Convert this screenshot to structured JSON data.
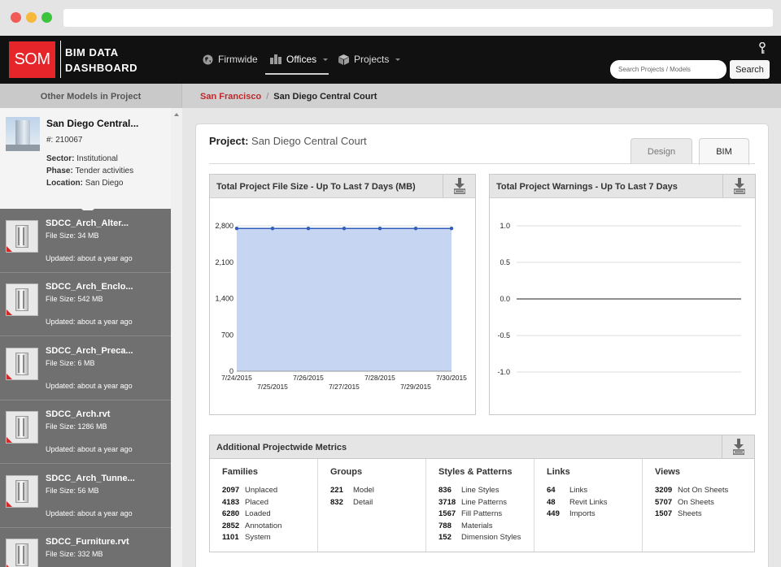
{
  "header": {
    "logo": "SOM",
    "brand_line1": "BIM DATA",
    "brand_line2": "DASHBOARD",
    "nav": [
      {
        "label": "Firmwide",
        "icon": "globe-icon"
      },
      {
        "label": "Offices",
        "icon": "city-icon"
      },
      {
        "label": "Projects",
        "icon": "cube-icon"
      }
    ],
    "search_placeholder": "Search Projects / Models",
    "search_button": "Search"
  },
  "subheader": {
    "sidebar_title": "Other Models in Project",
    "breadcrumb_link": "San Francisco",
    "breadcrumb_sep": "/",
    "breadcrumb_current": "San Diego Central Court"
  },
  "current_model": {
    "title": "San Diego Central...",
    "number": "#: 210067",
    "sector_label": "Sector:",
    "sector": "Institutional",
    "phase_label": "Phase:",
    "phase": "Tender activities",
    "location_label": "Location:",
    "location": "San Diego"
  },
  "models": [
    {
      "name": "SDCC_Arch_Alter...",
      "size": "File Size: 34 MB",
      "updated": "Updated: about a year ago"
    },
    {
      "name": "SDCC_Arch_Enclo...",
      "size": "File Size: 542 MB",
      "updated": "Updated: about a year ago"
    },
    {
      "name": "SDCC_Arch_Preca...",
      "size": "File Size: 6 MB",
      "updated": "Updated: about a year ago"
    },
    {
      "name": "SDCC_Arch.rvt",
      "size": "File Size: 1286 MB",
      "updated": "Updated: about a year ago"
    },
    {
      "name": "SDCC_Arch_Tunne...",
      "size": "File Size: 56 MB",
      "updated": "Updated: about a year ago"
    },
    {
      "name": "SDCC_Furniture.rvt",
      "size": "File Size: 332 MB",
      "updated": ""
    }
  ],
  "project": {
    "label": "Project:",
    "name": "San Diego Central Court",
    "tabs": [
      "Design",
      "BIM"
    ]
  },
  "chart_data": [
    {
      "type": "area",
      "title": "Total Project File Size - Up To Last 7 Days (MB)",
      "x": [
        "7/24/2015",
        "7/25/2015",
        "7/26/2015",
        "7/27/2015",
        "7/28/2015",
        "7/29/2015",
        "7/30/2015"
      ],
      "values": [
        2750,
        2750,
        2750,
        2750,
        2750,
        2750,
        2750
      ],
      "yticks": [
        0,
        700,
        1400,
        2100,
        2800
      ],
      "ylim": [
        0,
        2800
      ],
      "color": "#c5d5f2",
      "line_color": "#2f5db8"
    },
    {
      "type": "line",
      "title": "Total Project Warnings - Up To Last 7 Days",
      "x": [],
      "values": [
        0
      ],
      "yticks": [
        1.0,
        0.5,
        0.0,
        -0.5,
        -1.0
      ],
      "ytick_labels": [
        "1.0",
        "0.5",
        "0.0",
        "-0.5",
        "-1.0"
      ],
      "ylim": [
        -1.0,
        1.0
      ]
    }
  ],
  "metrics": {
    "title": "Additional Projectwide Metrics",
    "columns": [
      {
        "title": "Families",
        "rows": [
          {
            "n": "2097",
            "label": "Unplaced"
          },
          {
            "n": "4183",
            "label": "Placed"
          },
          {
            "n": "6280",
            "label": "Loaded"
          },
          {
            "n": "2852",
            "label": "Annotation"
          },
          {
            "n": "1101",
            "label": "System"
          }
        ]
      },
      {
        "title": "Groups",
        "rows": [
          {
            "n": "221",
            "label": "Model"
          },
          {
            "n": "832",
            "label": "Detail"
          }
        ]
      },
      {
        "title": "Styles & Patterns",
        "rows": [
          {
            "n": "836",
            "label": "Line Styles"
          },
          {
            "n": "3718",
            "label": "Line Patterns"
          },
          {
            "n": "1567",
            "label": "Fill Patterns"
          },
          {
            "n": "788",
            "label": "Materials"
          },
          {
            "n": "152",
            "label": "Dimension Styles"
          }
        ]
      },
      {
        "title": "Links",
        "rows": [
          {
            "n": "64",
            "label": "Links"
          },
          {
            "n": "48",
            "label": "Revit Links"
          },
          {
            "n": "449",
            "label": "Imports"
          }
        ]
      },
      {
        "title": "Views",
        "rows": [
          {
            "n": "3209",
            "label": "Not On Sheets"
          },
          {
            "n": "5707",
            "label": "On Sheets"
          },
          {
            "n": "1507",
            "label": "Sheets"
          }
        ]
      }
    ]
  }
}
